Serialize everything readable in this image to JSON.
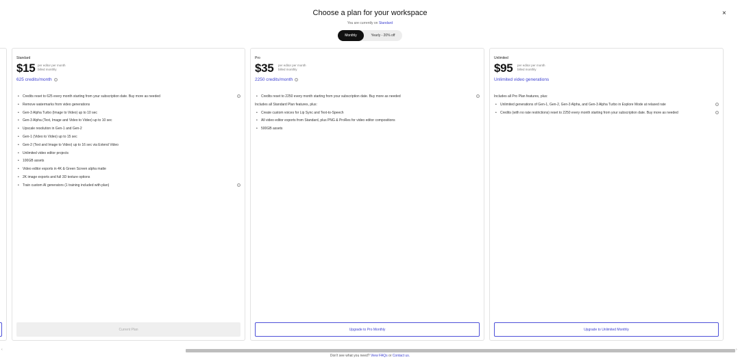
{
  "header": {
    "title": "Choose a plan for your workspace",
    "close_icon": "×",
    "current_prefix": "You are currently on",
    "current_plan": "Standard"
  },
  "billing_toggle": {
    "options": [
      "Monthly",
      "Yearly - 20% off"
    ],
    "selected": "Monthly"
  },
  "plans": [
    {
      "name": "Standard",
      "price": "$15",
      "per_line1": "per editor per month",
      "per_line2": "billed monthly",
      "credits": "625 credits/month",
      "features": [
        "Credits reset to 625 every month starting from your subscription date. Buy more as needed",
        "Remove watermarks from video generations",
        "Gen-3 Alpha Turbo (Image to Video) up to 10 sec",
        "Gen-3 Alpha (Text, Image and Video to Video) up to 10 sec",
        "Upscale resolution in Gen-1 and Gen-2",
        "Gen-1 (Video to Video) up to 15 sec",
        "Gen-2 (Text and Image to Video) up to 16 sec via Extend Video",
        "Unlimited video editor projects",
        "100GB assets",
        "Video editor exports in 4K & Green Screen alpha matte",
        "2K image exports and full 3D texture options",
        "Train custom AI generators (1 training included with plan)"
      ],
      "cta": "Current Plan"
    },
    {
      "name": "Pro",
      "price": "$35",
      "per_line1": "per editor per month",
      "per_line2": "billed monthly",
      "credits": "2250 credits/month",
      "features": [
        "Credits reset to 2250 every month starting from your subscription date. Buy more as needed",
        "Includes all Standard Plan features, plus:",
        "Create custom voices for Lip Sync and Text-to-Speech",
        "All video editor exports from Standard, plus PNG & ProRes for video editor compositions",
        "500GB assets"
      ],
      "cta": "Upgrade to Pro Monthly"
    },
    {
      "name": "Unlimited",
      "price": "$95",
      "per_line1": "per editor per month",
      "per_line2": "billed monthly",
      "credits": "Unlimited video generations",
      "features": [
        "Includes all Pro Plan features, plus:",
        "Unlimited generations of Gen-1, Gen-2, Gen-3 Alpha, and Gen-3 Alpha Turbo in Explore Mode at relaxed rate",
        "Credits (with no rate restrictions) reset to 2250 every month starting from your subscription date. Buy more as needed"
      ],
      "cta": "Upgrade to Unlimited Monthly"
    }
  ],
  "info_icon": "i",
  "scroll": {
    "left_arrow": "‹",
    "right_arrow": "›"
  },
  "footer": {
    "prefix": "Don't see what you need?",
    "faq_link": "View FAQs",
    "or": "or",
    "contact_link": "Contact us."
  },
  "colors": {
    "accent": "#3b3fd0",
    "toggle_active": "#111111"
  }
}
